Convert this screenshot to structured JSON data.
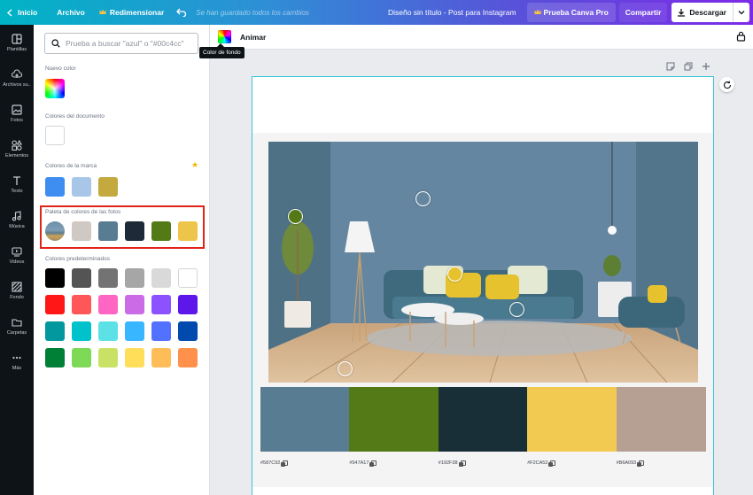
{
  "topbar": {
    "home": "Inicio",
    "file": "Archivo",
    "resize": "Redimensionar",
    "saved_status": "Se han guardado todos los cambios",
    "doc_title": "Diseño sin título - Post para Instagram",
    "pro_button": "Prueba Canva Pro",
    "share": "Compartir",
    "download": "Descargar"
  },
  "rail": [
    {
      "label": "Plantillas",
      "icon": "templates-icon"
    },
    {
      "label": "Archivos su..",
      "icon": "upload-cloud-icon"
    },
    {
      "label": "Fotos",
      "icon": "photos-icon"
    },
    {
      "label": "Elementos",
      "icon": "elements-icon"
    },
    {
      "label": "Texto",
      "icon": "text-icon"
    },
    {
      "label": "Música",
      "icon": "music-icon"
    },
    {
      "label": "Videos",
      "icon": "video-icon"
    },
    {
      "label": "Fondo",
      "icon": "background-icon"
    },
    {
      "label": "Carpetas",
      "icon": "folder-icon"
    },
    {
      "label": "Más",
      "icon": "more-icon"
    }
  ],
  "panel": {
    "search_placeholder": "Prueba a buscar \"azul\" o \"#00c4cc\"",
    "new_color": "Nuevo color",
    "document_colors": "Colores del documento",
    "brand_colors": "Colores de la marca",
    "photo_palette": "Paleta de colores de las fotos",
    "default_colors": "Colores predeterminados",
    "document_swatches": [
      "#FFFFFF"
    ],
    "brand_swatches": [
      "#3D8EF0",
      "#A8C7E8",
      "#C4A93F"
    ],
    "photo_swatches": [
      "#CFC8C3",
      "#587C92",
      "#1F2A38",
      "#547A17",
      "#EDC54A"
    ],
    "default_swatches": [
      "#000000",
      "#545454",
      "#737373",
      "#A6A6A6",
      "#D9D9D9",
      "#FFFFFF",
      "#FF1616",
      "#FF5757",
      "#FF66C4",
      "#CB6CE6",
      "#8C52FF",
      "#5E17EB",
      "#03989E",
      "#00C2CB",
      "#5CE1E6",
      "#38B6FF",
      "#5271FF",
      "#004AAD",
      "#008037",
      "#7ED957",
      "#C9E265",
      "#FFDE59",
      "#FFBD59",
      "#FF914D"
    ]
  },
  "editor": {
    "animate": "Animar",
    "tooltip": "Color de fondo"
  },
  "palette": [
    {
      "color": "#587C92",
      "hex": "#587C92"
    },
    {
      "color": "#547A17",
      "hex": "#547A17"
    },
    {
      "color": "#192F38",
      "hex": "#192F38"
    },
    {
      "color": "#F2CA52",
      "hex": "#F2CA52"
    },
    {
      "color": "#B6A093",
      "hex": "#B6A093"
    }
  ]
}
